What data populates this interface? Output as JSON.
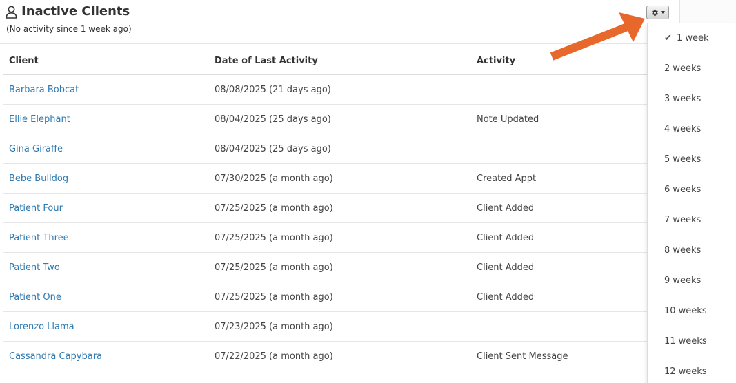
{
  "header": {
    "title": "Inactive Clients",
    "subtitle": "(No activity since 1 week ago)"
  },
  "table": {
    "columns": [
      "Client",
      "Date of Last Activity",
      "Activity"
    ],
    "rows": [
      {
        "client": "Barbara Bobcat",
        "date": "08/08/2025 (21 days ago)",
        "activity": ""
      },
      {
        "client": "Ellie Elephant",
        "date": "08/04/2025 (25 days ago)",
        "activity": "Note Updated"
      },
      {
        "client": "Gina Giraffe",
        "date": "08/04/2025 (25 days ago)",
        "activity": ""
      },
      {
        "client": "Bebe Bulldog",
        "date": "07/30/2025 (a month ago)",
        "activity": "Created Appt"
      },
      {
        "client": "Patient Four",
        "date": "07/25/2025 (a month ago)",
        "activity": "Client Added"
      },
      {
        "client": "Patient Three",
        "date": "07/25/2025 (a month ago)",
        "activity": "Client Added"
      },
      {
        "client": "Patient Two",
        "date": "07/25/2025 (a month ago)",
        "activity": "Client Added"
      },
      {
        "client": "Patient One",
        "date": "07/25/2025 (a month ago)",
        "activity": "Client Added"
      },
      {
        "client": "Lorenzo Llama",
        "date": "07/23/2025 (a month ago)",
        "activity": ""
      },
      {
        "client": "Cassandra Capybara",
        "date": "07/22/2025 (a month ago)",
        "activity": "Client Sent Message"
      }
    ]
  },
  "settings": {
    "button_icon": "gear-icon",
    "options": [
      "1 week",
      "2 weeks",
      "3 weeks",
      "4 weeks",
      "5 weeks",
      "6 weeks",
      "7 weeks",
      "8 weeks",
      "9 weeks",
      "10 weeks",
      "11 weeks",
      "12 weeks"
    ],
    "selected": "1 week"
  },
  "colors": {
    "link": "#2f7ab1",
    "annotation_arrow": "#e8672a"
  }
}
